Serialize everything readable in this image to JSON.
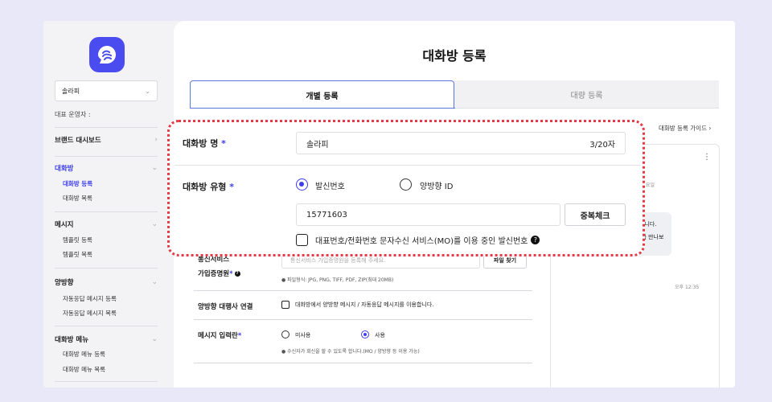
{
  "sidebar": {
    "account_select": "솔라피",
    "owner_label": "대표 운영자 :",
    "nav": [
      {
        "label": "브랜드 대시보드"
      },
      {
        "label": "대화방",
        "subs": [
          "대화방 등록",
          "대화방 목록"
        ]
      },
      {
        "label": "메시지",
        "subs": [
          "템플릿 등록",
          "템플릿 목록"
        ]
      },
      {
        "label": "양방향",
        "subs": [
          "자동응답 메시지 등록",
          "자동응답 메시지 목록"
        ]
      },
      {
        "label": "대화방 메뉴",
        "subs": [
          "대화방 메뉴 등록",
          "대화방 메뉴 목록"
        ]
      }
    ]
  },
  "main": {
    "title": "대화방 등록",
    "tabs": [
      "개별 등록",
      "대량 등록"
    ],
    "guide_link": "대화방 등록 가이드",
    "telecom_label_1": "통신서비스",
    "telecom_label_2": "가입증명원",
    "telecom_placeholder": "통신서비스 가입증명원을 등록해 주세요.",
    "file_button": "파일 찾기",
    "file_hint": "● 파일형식: JPG, PNG, TIFF, PDF, ZIP(최대 20MB)",
    "agency_label": "양방향 대행사 연결",
    "agency_check_label": "대화방에서 양방향 메시지 / 자동응답 메시지를 이용합니다.",
    "msg_input_label": "메시지 입력란",
    "msg_opt_off": "미사용",
    "msg_opt_on": "사용",
    "msg_hint": "● 수신자가 회신을 할 수 있도록 합니다.(MO / 양방향 등 이용 가능)"
  },
  "preview": {
    "date_text": "요일",
    "bubble_line1": "합니다.",
    "bubble_line2": "지금 만나보",
    "bubble_line3": "요.",
    "time": "오후 12:35"
  },
  "overlay": {
    "name_label": "대화방 명",
    "name_value": "솔라피",
    "name_counter": "3/20자",
    "type_label": "대화방 유형",
    "type_opt_sender": "발신번호",
    "type_opt_twoway": "양방향 ID",
    "number_value": "15771603",
    "dup_button": "중복체크",
    "mo_label": "대표번호/전화번호 문자수신 서비스(MO)를 이용 중인 발신번호"
  },
  "colors": {
    "accent": "#3d3ded",
    "highlight": "#e53946",
    "background": "#e9e8f8"
  }
}
